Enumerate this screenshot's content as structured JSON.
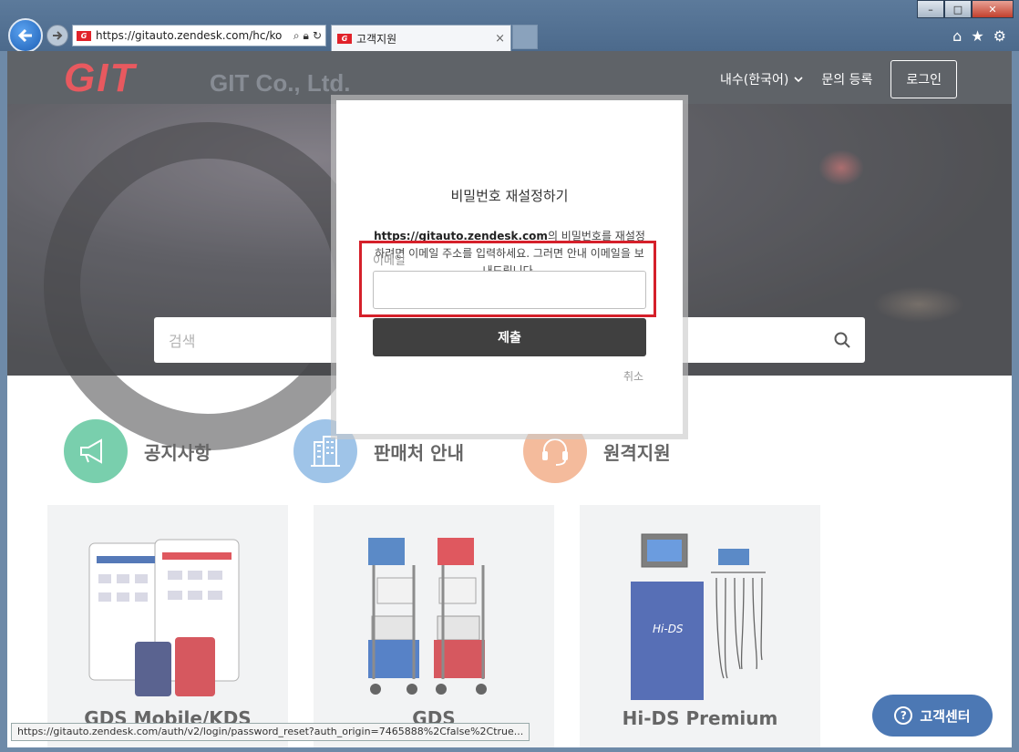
{
  "browser": {
    "url": "https://gitauto.zendesk.com/hc/ko",
    "tab_title": "고객지원",
    "tab_close": "×",
    "status_url": "https://gitauto.zendesk.com/auth/v2/login/password_reset?auth_origin=7465888%2Cfalse%2Ctrue..."
  },
  "header": {
    "logo_mark": "GIT",
    "logo_name": "GIT Co., Ltd.",
    "lang": "내수(한국어)",
    "submit_request": "문의 등록",
    "login": "로그인"
  },
  "search": {
    "placeholder": "검색"
  },
  "categories": [
    {
      "label": "공지사항",
      "color": "#4dbf92",
      "icon": "megaphone-icon"
    },
    {
      "label": "판매처 안내",
      "color": "#7fb1e0",
      "icon": "building-icon"
    },
    {
      "label": "원격지원",
      "color": "#f0a47b",
      "icon": "headset-icon"
    }
  ],
  "cards": [
    {
      "label": "GDS Mobile/KDS"
    },
    {
      "label": "GDS"
    },
    {
      "label": "Hi-DS Premium"
    }
  ],
  "fab": {
    "label": "고객센터",
    "icon": "question-icon"
  },
  "modal": {
    "title": "비밀번호 재설정하기",
    "desc_domain": "https://gitauto.zendesk.com",
    "desc_rest": "의 비밀번호를 재설정하려면 이메일 주소를 입력하세요. 그러면 안내 이메일을 보내드립니다.",
    "email_label": "이메일",
    "email_value": "",
    "submit": "제출",
    "cancel": "취소"
  },
  "colors": {
    "brand_red": "#e1222a",
    "header_bg": "#2a2f36",
    "highlight": "#d5202a",
    "fab": "#104b9b"
  }
}
